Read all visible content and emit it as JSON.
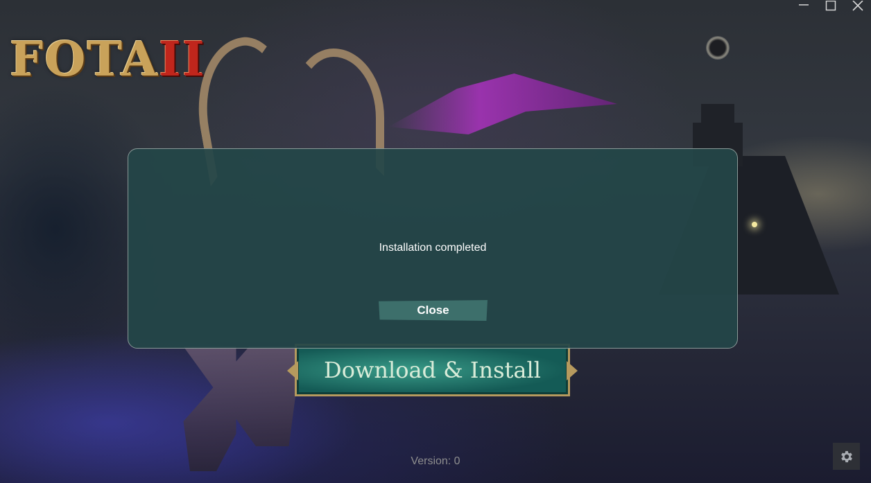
{
  "app": {
    "logo_text": "FOTA",
    "logo_numeral": "II"
  },
  "window_controls": {
    "minimize_icon": "minimize-icon",
    "maximize_icon": "maximize-icon",
    "close_icon": "close-icon"
  },
  "main": {
    "download_label": "Download & Install",
    "version_text": "Version: 0"
  },
  "dialog": {
    "message": "Installation completed",
    "close_label": "Close"
  },
  "settings": {
    "icon": "gear-icon"
  }
}
